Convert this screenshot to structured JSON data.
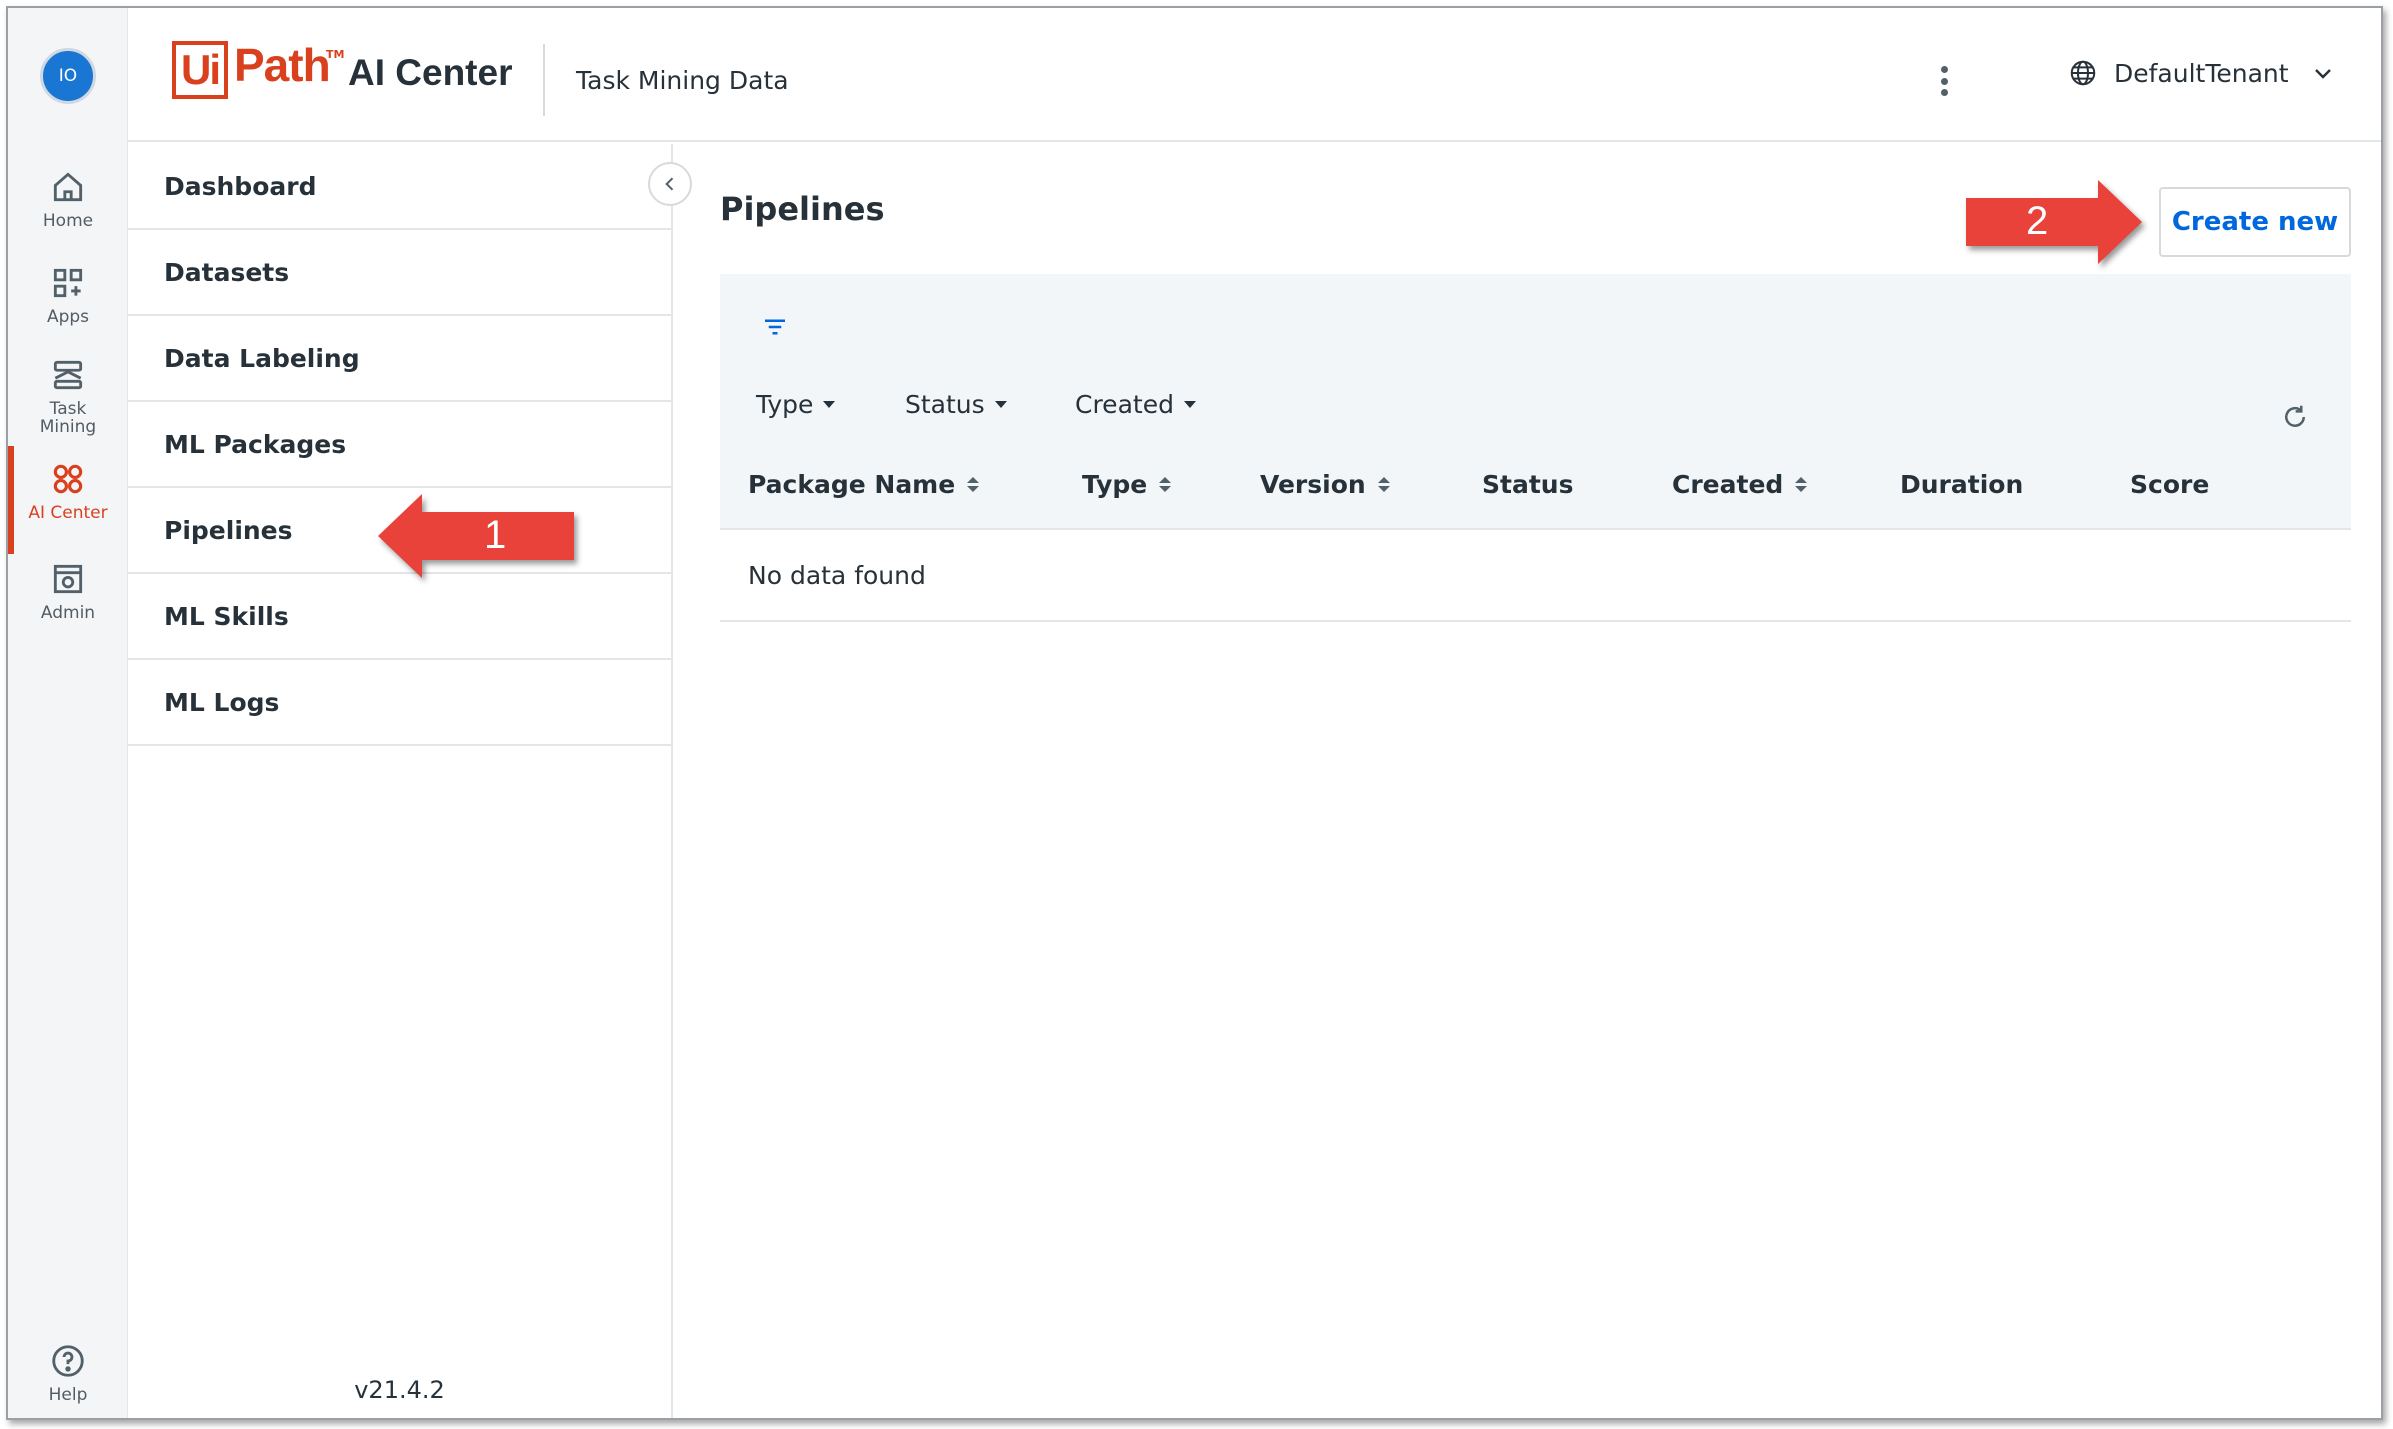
{
  "rail": {
    "avatar_initials": "IO",
    "items": [
      {
        "label": "Home",
        "icon": "home-icon"
      },
      {
        "label": "Apps",
        "icon": "apps-icon"
      },
      {
        "label": "Task\nMining",
        "icon": "task-mining-icon"
      },
      {
        "label": "AI Center",
        "icon": "ai-center-icon",
        "active": true
      },
      {
        "label": "Admin",
        "icon": "admin-icon"
      }
    ],
    "help_label": "Help"
  },
  "header": {
    "logo_ui": "Ui",
    "logo_path": "Path",
    "logo_tm": "TM",
    "product": "AI Center",
    "project": "Task Mining Data",
    "tenant": "DefaultTenant"
  },
  "sidenav": {
    "items": [
      "Dashboard",
      "Datasets",
      "Data Labeling",
      "ML Packages",
      "Pipelines",
      "ML Skills",
      "ML Logs"
    ],
    "version": "v21.4.2"
  },
  "main": {
    "title": "Pipelines",
    "create_button": "Create new",
    "filters": [
      "Type",
      "Status",
      "Created"
    ],
    "columns": [
      "Package Name",
      "Type",
      "Version",
      "Status",
      "Created",
      "Duration",
      "Score"
    ],
    "empty_text": "No data found"
  },
  "callouts": [
    "1",
    "2"
  ],
  "colors": {
    "brand": "#d9411e",
    "accent": "#0067df",
    "callout": "#e8423b"
  }
}
